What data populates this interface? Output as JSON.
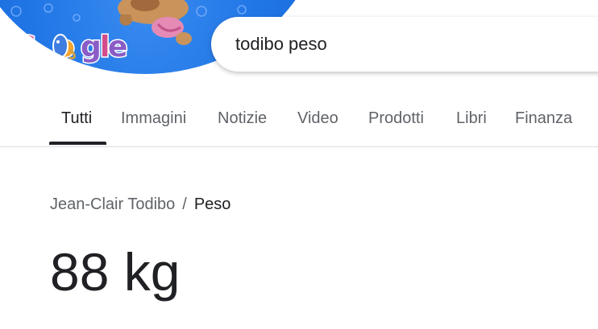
{
  "search": {
    "query": "todibo peso"
  },
  "tabs": [
    {
      "label": "Tutti",
      "active": true
    },
    {
      "label": "Immagini"
    },
    {
      "label": "Notizie"
    },
    {
      "label": "Video"
    },
    {
      "label": "Prodotti"
    },
    {
      "label": "Libri"
    },
    {
      "label": "Finanza"
    }
  ],
  "result": {
    "breadcrumb_entity": "Jean-Clair Todibo",
    "breadcrumb_separator": "/",
    "breadcrumb_attribute": "Peso",
    "answer": "88 kg"
  },
  "colors": {
    "doodle_blue": "#2176e6",
    "text_primary": "#202124",
    "text_secondary": "#5f6368",
    "divider": "#dadce0"
  }
}
